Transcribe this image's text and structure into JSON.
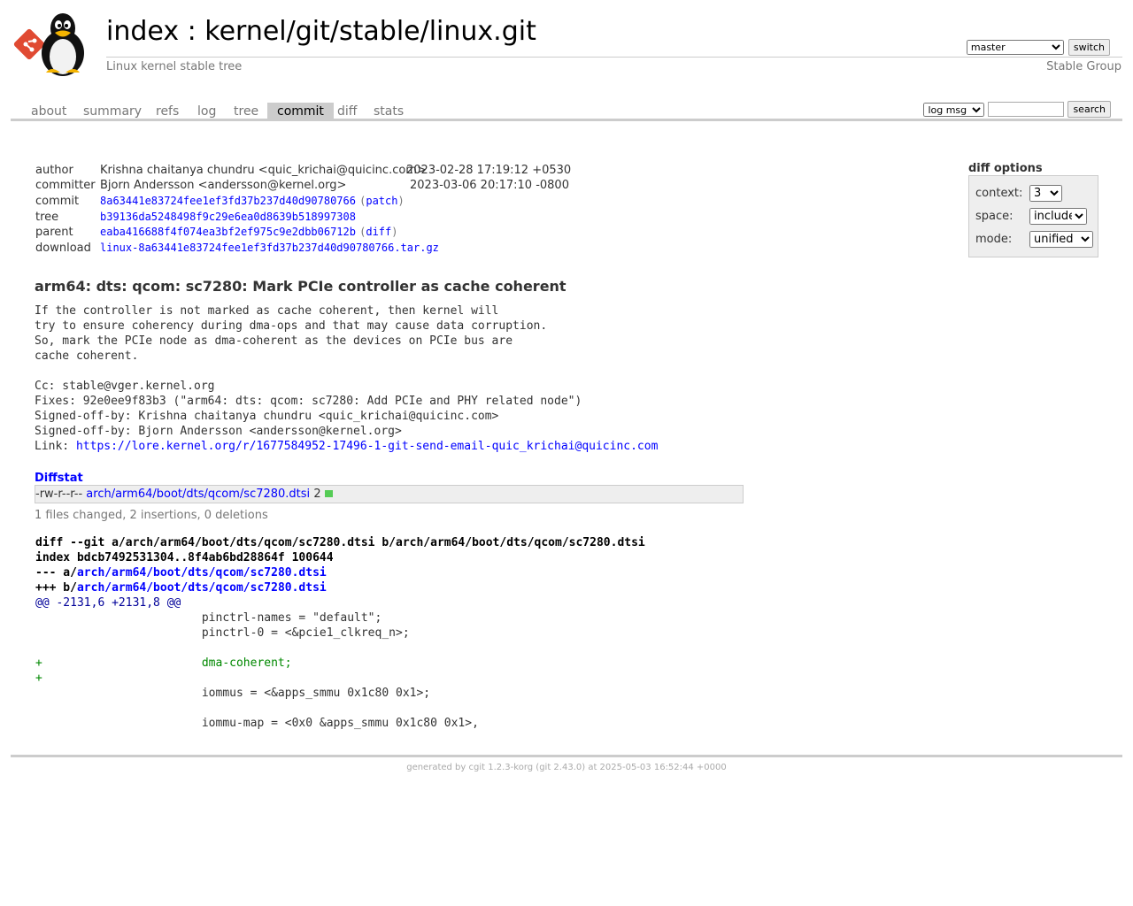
{
  "header": {
    "title_index": "index",
    "title_sep": " : ",
    "title_repo": "kernel/git/stable/linux.git",
    "subtitle": "Linux kernel stable tree",
    "owner": "Stable Group",
    "branch": "master",
    "switch_label": "switch"
  },
  "tabs": [
    "about",
    "summary",
    "refs",
    "log",
    "tree",
    "commit",
    "diff",
    "stats"
  ],
  "active_tab": "commit",
  "search": {
    "mode": "log msg",
    "button": "search"
  },
  "diff_options": {
    "title": "diff options",
    "context_label": "context:",
    "context_value": "3",
    "space_label": "space:",
    "space_value": "include",
    "mode_label": "mode:",
    "mode_value": "unified"
  },
  "commit": {
    "author_label": "author",
    "author": "Krishna chaitanya chundru <quic_krichai@quicinc.com>",
    "author_date": "2023-02-28 17:19:12 +0530",
    "committer_label": "committer",
    "committer": "Bjorn Andersson <andersson@kernel.org>",
    "committer_date": "2023-03-06 20:17:10 -0800",
    "commit_label": "commit",
    "commit_hash": "8a63441e83724fee1ef3fd37b237d40d90780766",
    "patch_link": "patch",
    "tree_label": "tree",
    "tree_hash": "b39136da5248498f9c29e6ea0d8639b518997308",
    "parent_label": "parent",
    "parent_hash": "eaba416688f4f074ea3bf2ef975c9e2dbb06712b",
    "diff_link": "diff",
    "download_label": "download",
    "download": "linux-8a63441e83724fee1ef3fd37b237d40d90780766.tar.gz",
    "subject": "arm64: dts: qcom: sc7280: Mark PCIe controller as cache coherent",
    "message_lines": [
      "If the controller is not marked as cache coherent, then kernel will",
      "try to ensure coherency during dma-ops and that may cause data corruption.",
      "So, mark the PCIe node as dma-coherent as the devices on PCIe bus are",
      "cache coherent.",
      "",
      "Cc: stable@vger.kernel.org",
      "Fixes: 92e0ee9f83b3 (\"arm64: dts: qcom: sc7280: Add PCIe and PHY related node\")",
      "Signed-off-by: Krishna chaitanya chundru <quic_krichai@quicinc.com>",
      "Signed-off-by: Bjorn Andersson <andersson@kernel.org>"
    ],
    "link_prefix": "Link: ",
    "link_url": "https://lore.kernel.org/r/1677584952-17496-1-git-send-email-quic_krichai@quicinc.com"
  },
  "diffstat": {
    "header": "Diffstat",
    "mode": "-rw-r--r--",
    "file": "arch/arm64/boot/dts/qcom/sc7280.dtsi",
    "count": "2",
    "summary": "1 files changed, 2 insertions, 0 deletions"
  },
  "diff": {
    "git_line": "diff --git a/arch/arm64/boot/dts/qcom/sc7280.dtsi b/arch/arm64/boot/dts/qcom/sc7280.dtsi",
    "index_line": "index bdcb7492531304..8f4ab6bd28864f 100644",
    "minus_prefix": "--- a/",
    "plus_prefix": "+++ b/",
    "file": "arch/arm64/boot/dts/qcom/sc7280.dtsi",
    "hunk": "@@ -2131,6 +2131,8 @@",
    "lines": [
      {
        "type": "ctx",
        "text": "                        pinctrl-names = \"default\";"
      },
      {
        "type": "ctx",
        "text": "                        pinctrl-0 = <&pcie1_clkreq_n>;"
      },
      {
        "type": "ctx",
        "text": ""
      },
      {
        "type": "add",
        "text": "+                       dma-coherent;"
      },
      {
        "type": "add",
        "text": "+"
      },
      {
        "type": "ctx",
        "text": "                        iommus = <&apps_smmu 0x1c80 0x1>;"
      },
      {
        "type": "ctx",
        "text": ""
      },
      {
        "type": "ctx",
        "text": "                        iommu-map = <0x0 &apps_smmu 0x1c80 0x1>,"
      }
    ]
  },
  "footer": {
    "prefix": "generated by ",
    "cgit": "cgit 1.2.3-korg",
    "git": " (git 2.43.0) at 2025-05-03 16:52:44 +0000"
  },
  "colors": {
    "link": "#0000ff",
    "addition": "#008000",
    "hunk": "#000099",
    "diffstat_bar": "#55cc55"
  },
  "icons": {
    "logo": "git-diamond-and-tux-penguin-logo"
  }
}
